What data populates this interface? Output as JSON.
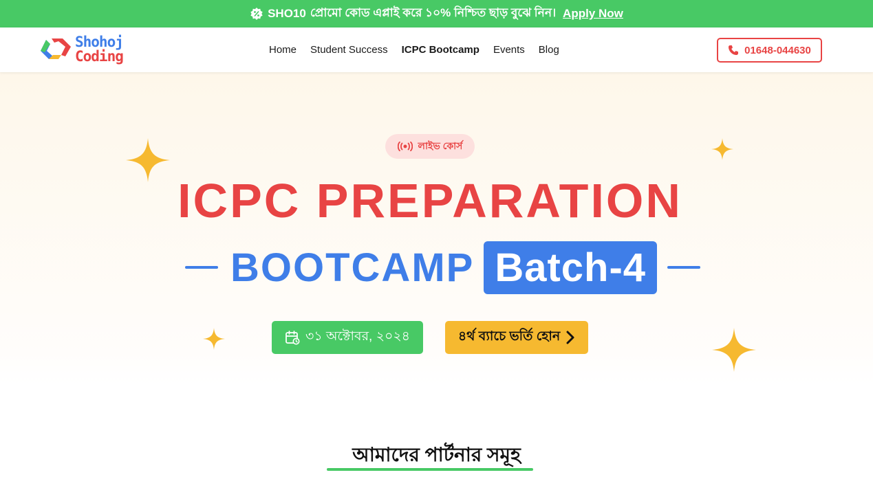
{
  "promo": {
    "code": "SHO10",
    "text": "প্রোমো কোড এপ্লাই করে ১০% নিশ্চিত ছাড় বুঝে নিন।",
    "apply_label": "Apply Now",
    "badge_icon": "discount-badge-icon"
  },
  "logo": {
    "line1": "Shohoj",
    "line2": "Coding"
  },
  "nav": {
    "items": [
      {
        "label": "Home"
      },
      {
        "label": "Student Success"
      },
      {
        "label": "ICPC Bootcamp"
      },
      {
        "label": "Events"
      },
      {
        "label": "Blog"
      }
    ],
    "active": "ICPC Bootcamp"
  },
  "phone": {
    "label": "01648-044630",
    "icon": "phone-icon"
  },
  "hero": {
    "live_label": "লাইভ কোর্স",
    "live_icon": "live-broadcast-icon",
    "title_line1": "ICPC PREPARATION",
    "title_bootcamp": "BOOTCAMP",
    "title_batch": "Batch-4",
    "date_label": "৩১ অক্টোবর, ২০২৪",
    "date_icon": "calendar-icon",
    "enroll_label": "৪র্থ ব্যাচে ভর্তি হোন",
    "enroll_icon": "chevron-right-icon"
  },
  "partners": {
    "title": "আমাদের পার্টনার সমূহ"
  },
  "colors": {
    "green": "#48c965",
    "red": "#e84444",
    "blue": "#3f7ee8",
    "yellow": "#f6b930"
  }
}
